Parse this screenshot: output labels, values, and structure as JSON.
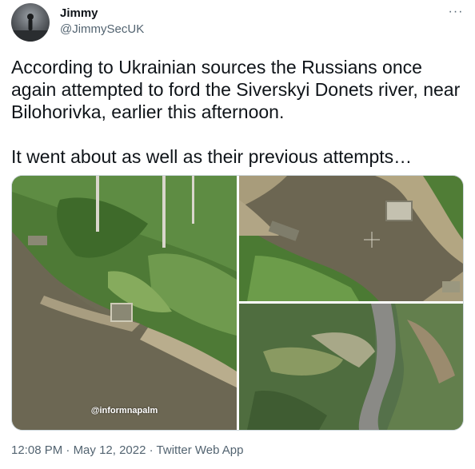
{
  "author": {
    "display_name": "Jimmy",
    "handle": "@JimmySecUK"
  },
  "more_icon": "more-horizontal-icon",
  "more_glyph": "···",
  "tweet": {
    "text": "According to Ukrainian sources the Russians once again attempted to ford the Siverskyi Donets river, near Bilohorivka, earlier this afternoon.\n\nIt went about as well as their previous attempts…"
  },
  "media": {
    "watermark": "@informnapalm"
  },
  "footer": {
    "time": "12:08 PM",
    "separator": " · ",
    "date": "May 12, 2022",
    "source": "Twitter Web App"
  },
  "colors": {
    "text": "#0f1419",
    "secondary": "#536471",
    "border": "#cfd9de",
    "river": "#6b6550",
    "foliage": "#4d7a35"
  }
}
